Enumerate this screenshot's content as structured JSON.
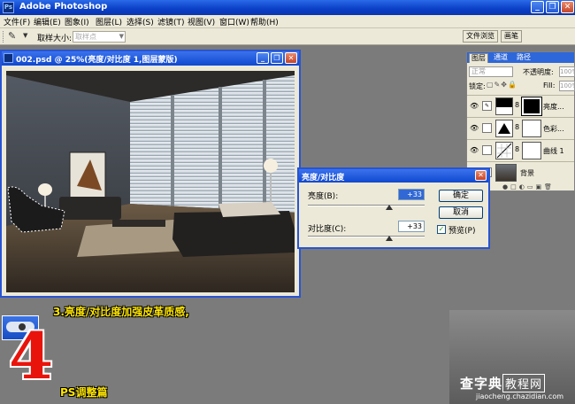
{
  "app": {
    "title": "Adobe Photoshop",
    "icon_label": "Ps"
  },
  "window_controls": {
    "minimize": "_",
    "restore": "❐",
    "close": "✕"
  },
  "menu": [
    {
      "label": "文件(F)"
    },
    {
      "label": "编辑(E)"
    },
    {
      "label": "图象(I)"
    },
    {
      "label": "图层(L)"
    },
    {
      "label": "选择(S)"
    },
    {
      "label": "滤镜(T)"
    },
    {
      "label": "视图(V)"
    },
    {
      "label": "窗口(W)"
    },
    {
      "label": "帮助(H)"
    }
  ],
  "options_bar": {
    "tool_icon": "eyedropper-icon",
    "sample_size_label": "取样大小:",
    "sample_size_value": "取样点",
    "file_browser_tab": "文件浏览",
    "brushes_tab": "画笔"
  },
  "document": {
    "title": "002.psd @ 25%(亮度/对比度 1,图层蒙版)"
  },
  "layers_panel": {
    "tabs": [
      "图层",
      "通道",
      "路径"
    ],
    "blend_mode": "正常",
    "opacity_label": "不透明度:",
    "opacity_value": "100%",
    "lock_label": "锁定:",
    "fill_label": "Fill:",
    "fill_value": "100%",
    "layers": [
      {
        "name": "亮度..."
      },
      {
        "name": "色彩..."
      },
      {
        "name": "曲线 1"
      },
      {
        "name": "背景"
      }
    ]
  },
  "dialog": {
    "title": "亮度/对比度",
    "brightness_label": "亮度(B):",
    "brightness_value": "+33",
    "contrast_label": "对比度(C):",
    "contrast_value": "+33",
    "ok_label": "确定",
    "cancel_label": "取消",
    "preview_label": "预览(P)",
    "preview_checked": true,
    "brightness_level": 0.7,
    "contrast_level": 0.7
  },
  "captions": {
    "step": "3.亮度/对比度加强皮革质感,",
    "number": "4",
    "section": "PS调整篇"
  },
  "watermark": {
    "line1a": "查字典",
    "line1b": "教程网",
    "line2": "jiaocheng.chazidian.com"
  }
}
